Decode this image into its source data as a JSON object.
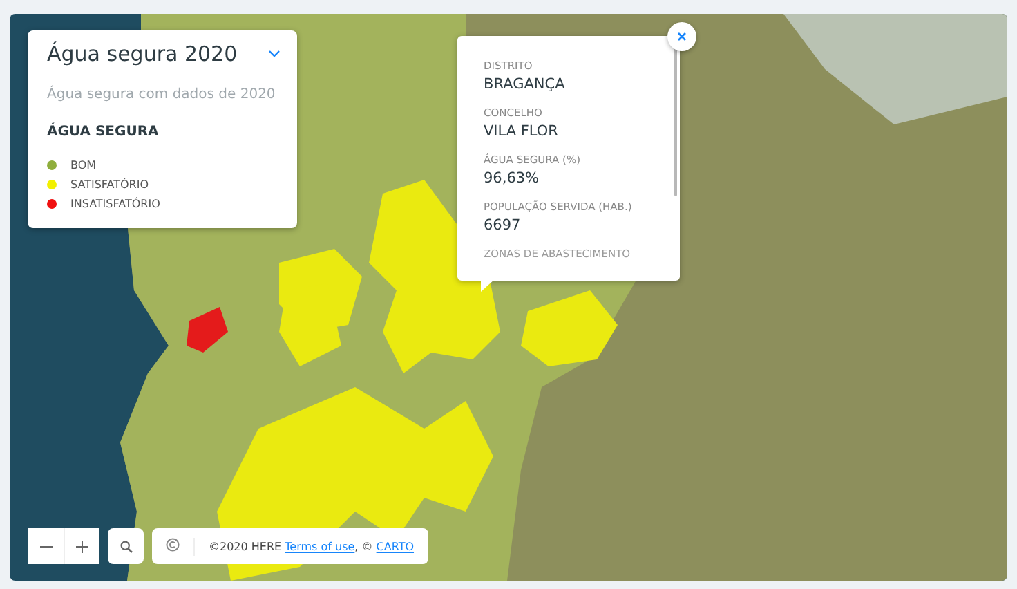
{
  "legend": {
    "title": "Água segura 2020",
    "subtitle": "Água segura com dados de 2020",
    "section_title": "ÁGUA SEGURA",
    "items": [
      {
        "label": "BOM",
        "color": "#8fae3c"
      },
      {
        "label": "SATISFATÓRIO",
        "color": "#f2f000"
      },
      {
        "label": "INSATISFATÓRIO",
        "color": "#f01010"
      }
    ]
  },
  "popup": {
    "fields": [
      {
        "label": "DISTRITO",
        "value": "BRAGANÇA"
      },
      {
        "label": "CONCELHO",
        "value": "VILA FLOR"
      },
      {
        "label": "ÁGUA SEGURA (%)",
        "value": "96,63%"
      },
      {
        "label": "POPULAÇÃO SERVIDA (HAB.)",
        "value": "6697"
      }
    ],
    "next_label": "ZONAS DE ABASTECIMENTO"
  },
  "attribution": {
    "prefix": "©2020 HERE",
    "links": [
      "Terms of use",
      "CARTO"
    ],
    "separator": ", ©"
  }
}
